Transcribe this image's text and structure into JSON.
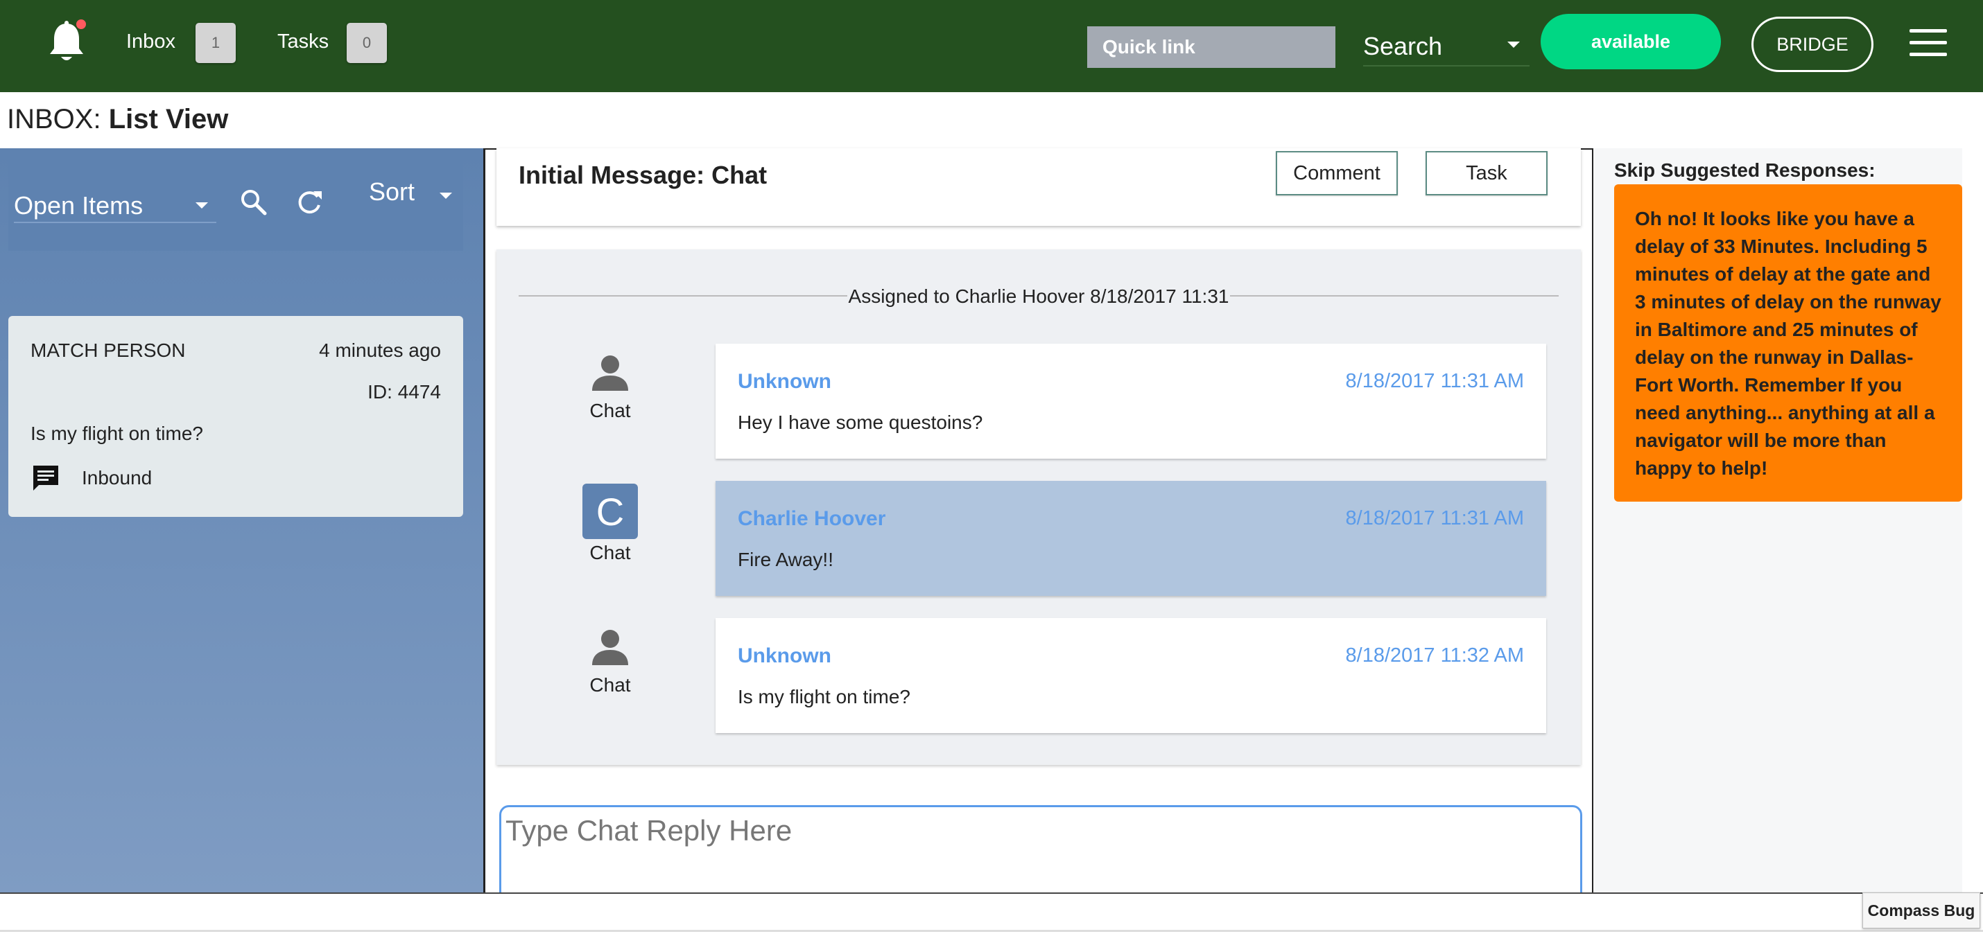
{
  "header": {
    "inbox_label": "Inbox",
    "inbox_count": "1",
    "tasks_label": "Tasks",
    "tasks_count": "0",
    "quicklink_placeholder": "Quick link",
    "search_label": "Search",
    "status_button": "available",
    "bridge_button": "BRIDGE",
    "colors": {
      "bar": "#24501f",
      "available": "#00d784",
      "notification_dot": "#ff5a5f"
    }
  },
  "page": {
    "title_prefix": "INBOX:",
    "title_view": "List View"
  },
  "left_panel": {
    "filter_label": "Open Items",
    "sort_label": "Sort",
    "icons": [
      "search-icon",
      "refresh-icon",
      "chevron-down-icon"
    ],
    "item": {
      "name": "MATCH PERSON",
      "time": "4 minutes ago",
      "id": "ID: 4474",
      "preview": "Is my flight on time?",
      "direction": "Inbound"
    }
  },
  "center": {
    "initial_title": "Initial Message: Chat",
    "comment_button": "Comment",
    "task_button": "Task",
    "assigned_text": "Assigned to Charlie Hoover 8/18/2017 11:31",
    "messages": [
      {
        "avatar_label": "Chat",
        "sender": "Unknown",
        "timestamp": "8/18/2017 11:31 AM",
        "body": "Hey I have some questoins?"
      },
      {
        "avatar_letter": "C",
        "avatar_label": "Chat",
        "sender": "Charlie Hoover",
        "timestamp": "8/18/2017 11:31 AM",
        "body": "Fire Away!!"
      },
      {
        "avatar_label": "Chat",
        "sender": "Unknown",
        "timestamp": "8/18/2017 11:32 AM",
        "body": "Is my flight on time?"
      }
    ],
    "reply_placeholder": "Type Chat Reply Here"
  },
  "right_panel": {
    "title": "Skip Suggested Responses:",
    "suggestion": "Oh no! It looks like you have a delay of 33 Minutes. Including 5 minutes of delay at the gate and 3 minutes of delay on the runway in Baltimore and 25 minutes of delay on the runway in Dallas-Fort Worth. Remember If you need anything... anything at all a navigator will be more than happy to help!",
    "colors": {
      "suggestion_bg": "#ff7f00"
    }
  },
  "footer": {
    "compass_bug": "Compass Bug"
  }
}
